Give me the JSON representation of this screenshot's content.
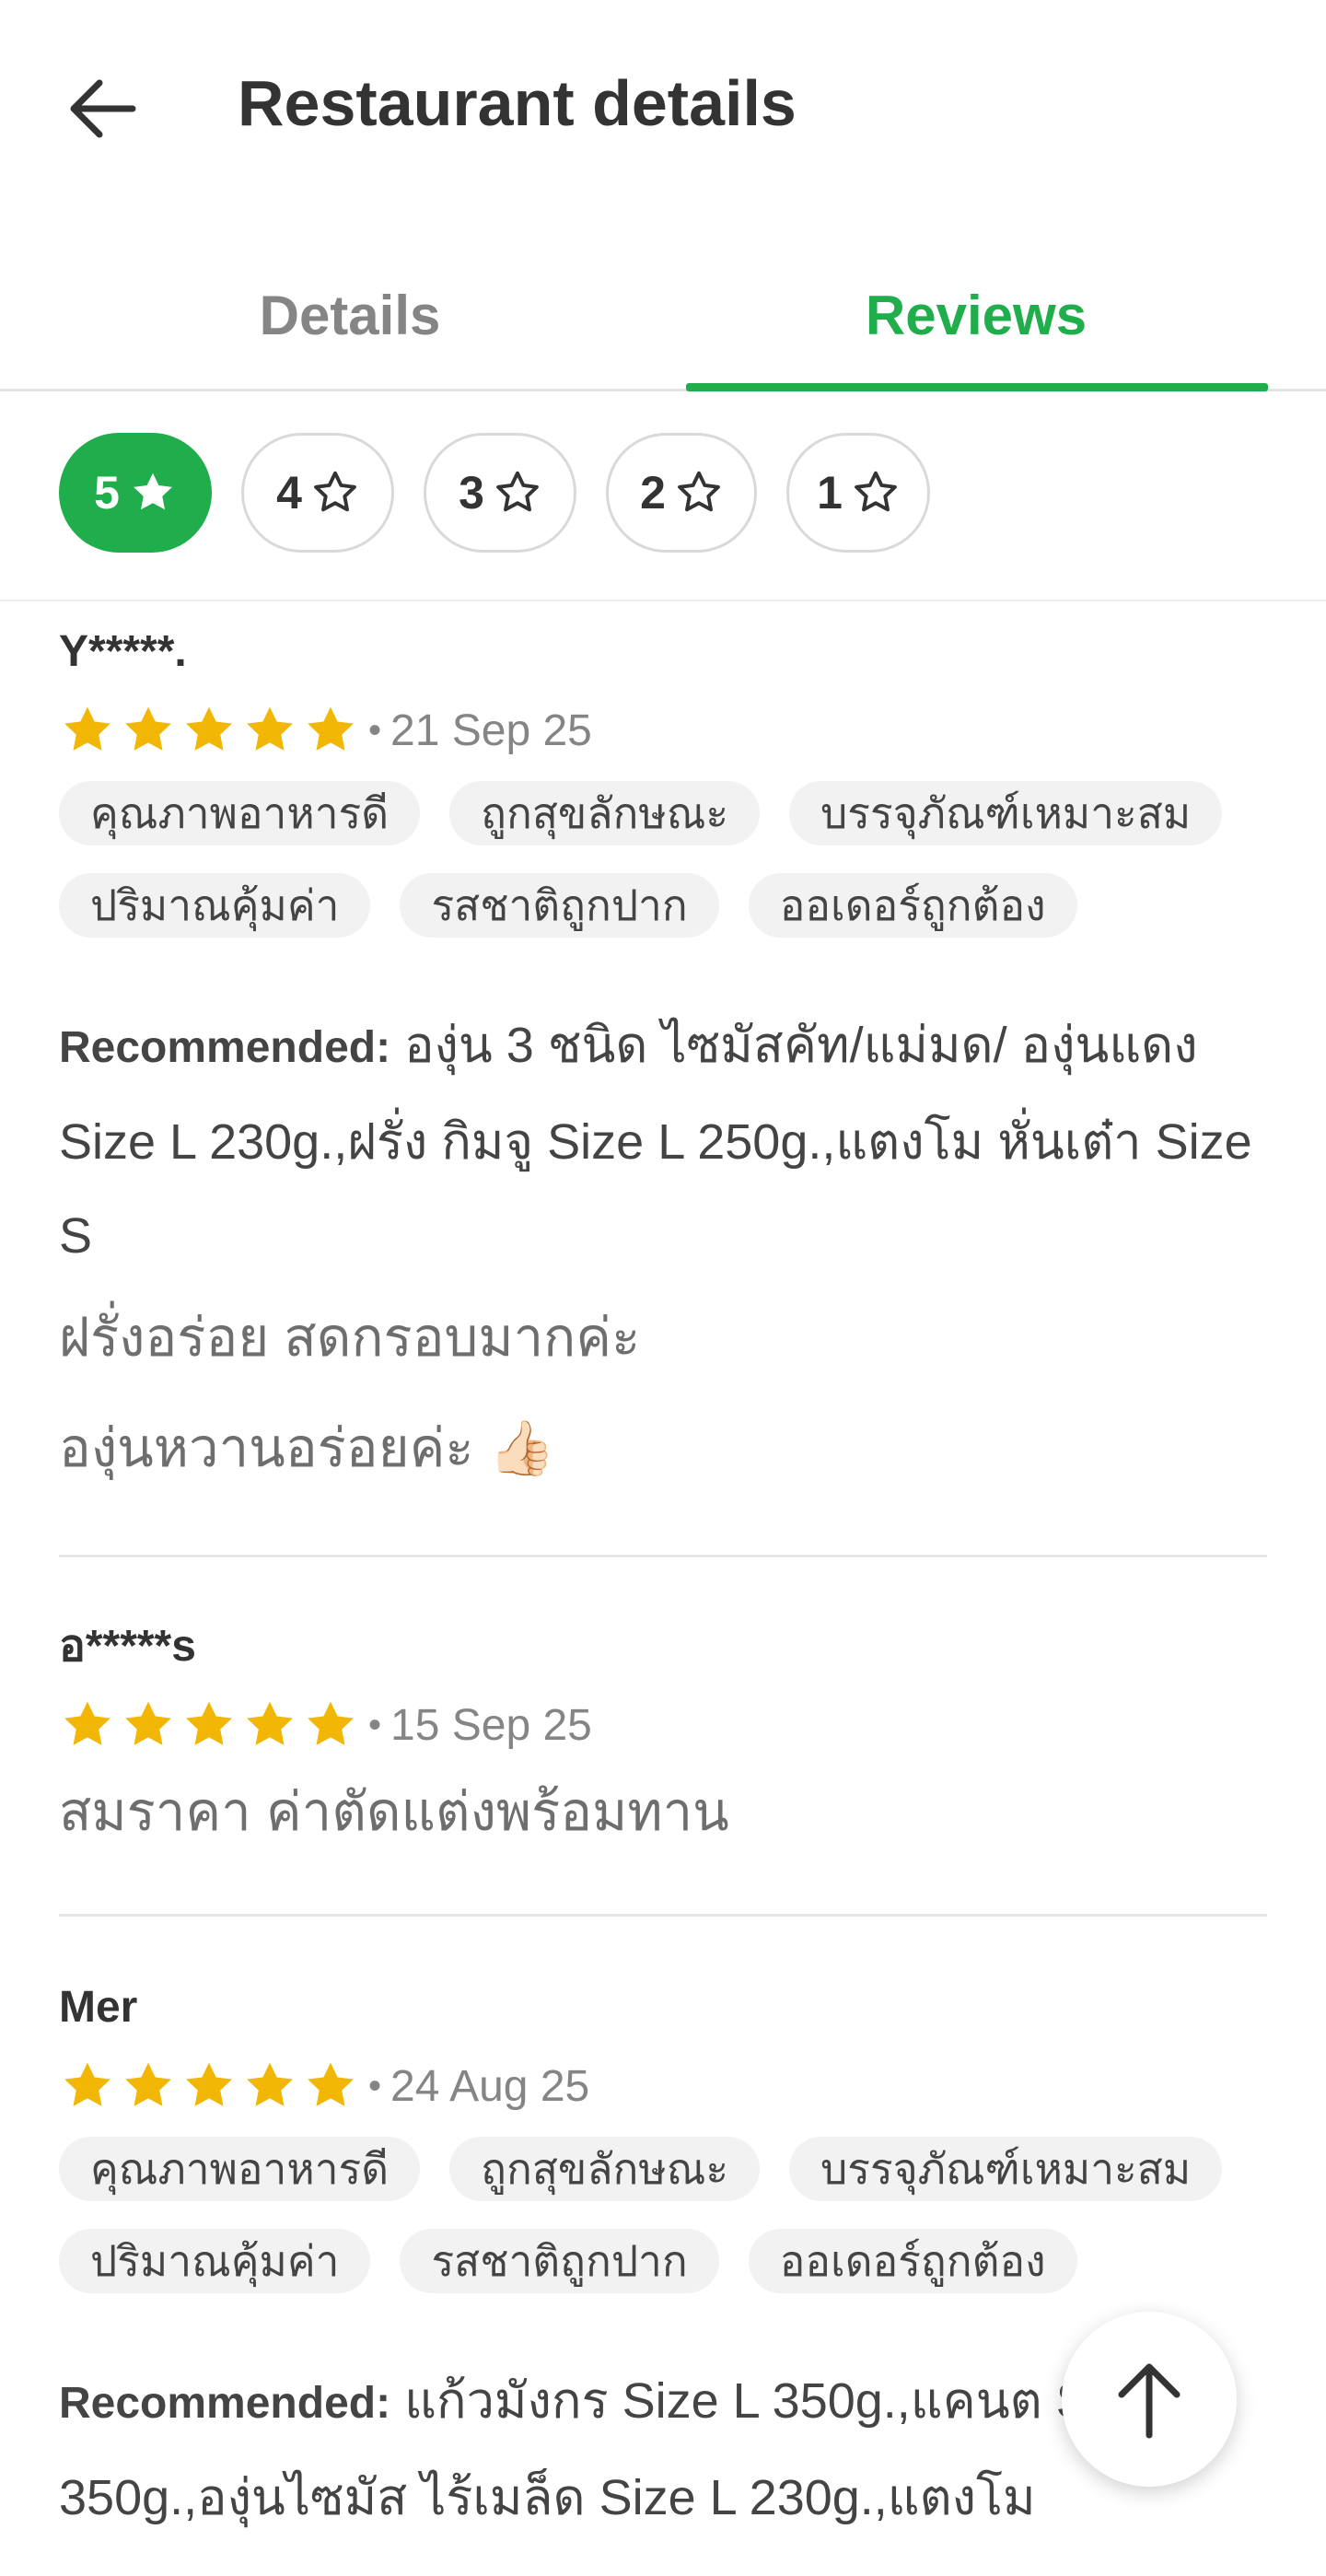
{
  "header": {
    "title": "Restaurant details"
  },
  "tabs": [
    {
      "label": "Details"
    },
    {
      "label": "Reviews"
    }
  ],
  "filters": [
    {
      "label": "5"
    },
    {
      "label": "4"
    },
    {
      "label": "3"
    },
    {
      "label": "2"
    },
    {
      "label": "1"
    }
  ],
  "reviews": [
    {
      "name": "Y*****.",
      "rating": 5,
      "date": "21 Sep 25",
      "tags": [
        "คุณภาพอาหารดี",
        "ถูกสุขลักษณะ",
        "บรรจุภัณฑ์เหมาะสม",
        "ปริมาณคุ้มค่า",
        "รสชาติถูกปาก",
        "ออเดอร์ถูกต้อง"
      ],
      "recommended_label": "Recommended:",
      "recommended_text": "องุ่น 3 ชนิด ไซมัสคัท/แม่มด/ องุ่นแดง Size L 230g.,ฝรั่ง กิมจู Size L 250g.,แตงโม หั่นเต๋า Size S",
      "comment_lines": [
        "ฝรั่งอร่อย สดกรอบมากค่ะ",
        "องุ่นหวานอร่อยค่ะ 👍🏻"
      ]
    },
    {
      "name": "อ*****s",
      "rating": 5,
      "date": "15 Sep 25",
      "comment_lines": [
        "สมราคา ค่าตัดแต่งพร้อมทาน"
      ]
    },
    {
      "name": "Mer",
      "rating": 5,
      "date": "24 Aug 25",
      "tags": [
        "คุณภาพอาหารดี",
        "ถูกสุขลักษณะ",
        "บรรจุภัณฑ์เหมาะสม",
        "ปริมาณคุ้มค่า",
        "รสชาติถูกปาก",
        "ออเดอร์ถูกต้อง"
      ],
      "recommended_label": "Recommended:",
      "recommended_text": "แก้วมังกร Size L 350g.,แคนต Size L 350g.,องุ่นไซมัส ไร้เมล็ด Size L 230g.,แตงโม"
    }
  ],
  "colors": {
    "accent": "#1fae4b",
    "star": "#f2b705"
  },
  "icons": {
    "back": "arrow-left-icon",
    "star": "star-icon",
    "scroll_top": "arrow-up-icon"
  }
}
